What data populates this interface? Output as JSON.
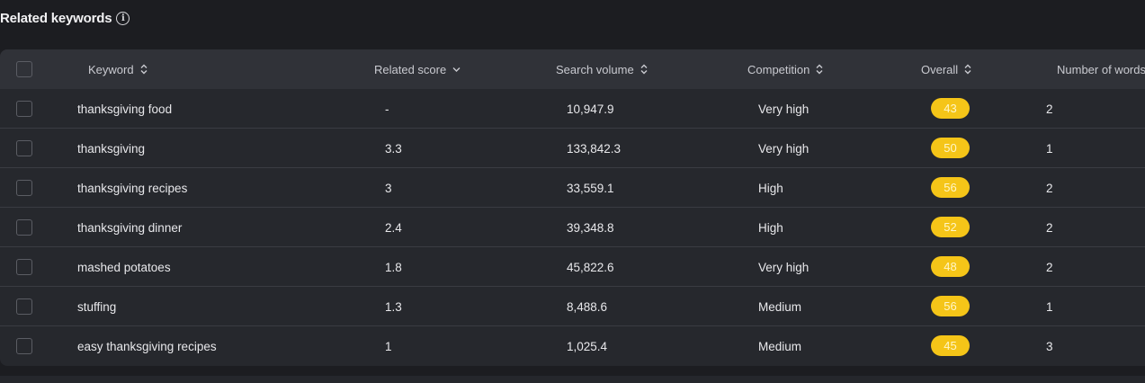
{
  "section": {
    "title": "Related keywords",
    "info_icon": "info-circle-icon"
  },
  "table": {
    "columns": [
      {
        "label": "Keyword",
        "sort_icon": "sort-both-icon"
      },
      {
        "label": "Related score",
        "sort_icon": "sort-down-icon"
      },
      {
        "label": "Search volume",
        "sort_icon": "sort-both-icon"
      },
      {
        "label": "Competition",
        "sort_icon": "sort-both-icon"
      },
      {
        "label": "Overall",
        "sort_icon": "sort-both-icon"
      },
      {
        "label": "Number of words",
        "sort_icon": "sort-both-icon"
      }
    ],
    "rows": [
      {
        "keyword": "thanksgiving food",
        "related_score": "-",
        "search_volume": "10,947.9",
        "competition": "Very high",
        "overall": "43",
        "words": "2"
      },
      {
        "keyword": "thanksgiving",
        "related_score": "3.3",
        "search_volume": "133,842.3",
        "competition": "Very high",
        "overall": "50",
        "words": "1"
      },
      {
        "keyword": "thanksgiving recipes",
        "related_score": "3",
        "search_volume": "33,559.1",
        "competition": "High",
        "overall": "56",
        "words": "2"
      },
      {
        "keyword": "thanksgiving dinner",
        "related_score": "2.4",
        "search_volume": "39,348.8",
        "competition": "High",
        "overall": "52",
        "words": "2"
      },
      {
        "keyword": "mashed potatoes",
        "related_score": "1.8",
        "search_volume": "45,822.6",
        "competition": "Very high",
        "overall": "48",
        "words": "2"
      },
      {
        "keyword": "stuffing",
        "related_score": "1.3",
        "search_volume": "8,488.6",
        "competition": "Medium",
        "overall": "56",
        "words": "1"
      },
      {
        "keyword": "easy thanksgiving recipes",
        "related_score": "1",
        "search_volume": "1,025.4",
        "competition": "Medium",
        "overall": "45",
        "words": "3"
      }
    ]
  },
  "colors": {
    "background": "#1c1d21",
    "table_bg": "#26282d",
    "header_bg": "#303238",
    "badge": "#f5c518"
  }
}
